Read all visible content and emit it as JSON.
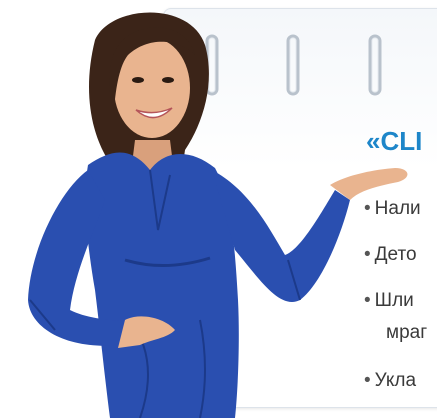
{
  "card": {
    "title": "«CLI",
    "bullets": [
      "Нали",
      "Дето",
      "Шли",
      "Укла"
    ],
    "bullet_continuation": "мраг"
  },
  "colors": {
    "title": "#1d86c9",
    "shirt": "#2a4fb0",
    "hair": "#3b2418",
    "skin": "#e9b48f"
  },
  "icons": [
    "notebook-ring-icon"
  ]
}
